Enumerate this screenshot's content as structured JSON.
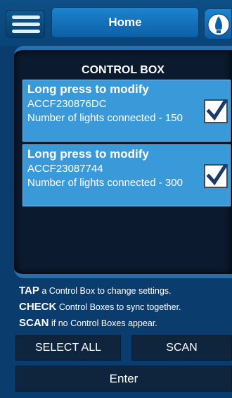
{
  "header": {
    "title": "Home",
    "menu_icon": "hamburger-menu-icon",
    "bulb_icon": "light-bulb-icon"
  },
  "panel": {
    "title": "CONTROL BOX",
    "boxes": [
      {
        "title": "Long press to modify",
        "id": "ACCF230876DC",
        "count_label": "Number of lights connected - 150",
        "checked": true
      },
      {
        "title": "Long press to modify",
        "id": "ACCF23087744",
        "count_label": "Number of lights connected - 300",
        "checked": true
      }
    ]
  },
  "instructions": [
    {
      "keyword": "TAP",
      "text": " a Control Box to change settings."
    },
    {
      "keyword": "CHECK",
      "text": " Control Boxes to sync together."
    },
    {
      "keyword": "SCAN",
      "text": " if no Control Boxes appear."
    }
  ],
  "buttons": {
    "select_all": "SELECT ALL",
    "scan": "SCAN",
    "enter": "Enter"
  },
  "colors": {
    "background": "#0a3d6e",
    "card": "#3a9ad9",
    "panel": "#0b1a2e",
    "button": "#0e253d"
  }
}
